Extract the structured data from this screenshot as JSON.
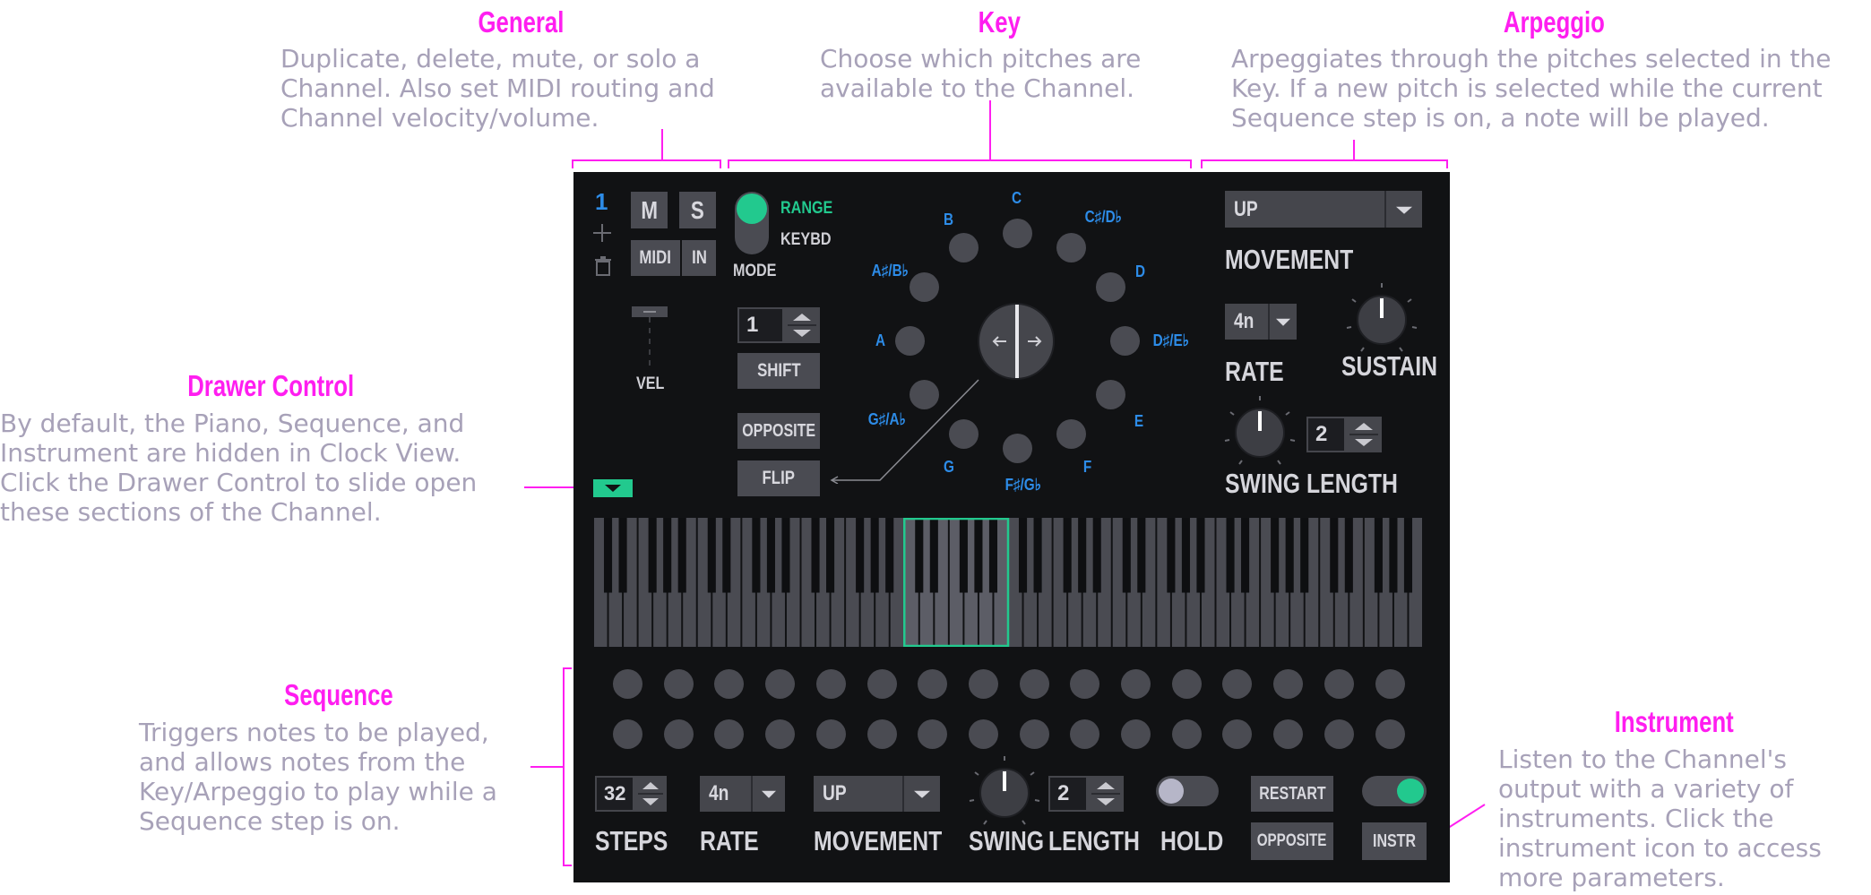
{
  "annotations": {
    "general": {
      "title": "General",
      "body": "Duplicate, delete, mute, or solo a\nChannel. Also set MIDI routing and\nChannel velocity/volume."
    },
    "key": {
      "title": "Key",
      "body": "Choose which pitches are\navailable to the Channel."
    },
    "arpeggio": {
      "title": "Arpeggio",
      "body": "Arpeggiates through the pitches selected in the\nKey. If a new pitch is selected while the current\nSequence step is on, a note will be played."
    },
    "drawer": {
      "title": "Drawer Control",
      "body": "By default, the Piano, Sequence, and\nInstrument are hidden in Clock View.\nClick the Drawer Control to slide open\nthese sections of the Channel."
    },
    "sequence": {
      "title": "Sequence",
      "body": "Triggers notes to be played,\nand allows notes from the\nKey/Arpeggio to play while a\nSequence step is on."
    },
    "instrument": {
      "title": "Instrument",
      "body": "Listen to the Channel's\noutput with a variety of\ninstruments. Click the\ninstrument icon to access\nmore parameters."
    }
  },
  "general": {
    "channel_number": "1",
    "add_icon": "plus-icon",
    "delete_icon": "trash-icon",
    "mute": "M",
    "solo": "S",
    "midi": "MIDI",
    "in": "IN",
    "velocity_label": "VEL"
  },
  "key": {
    "mode_options": [
      "RANGE",
      "KEYBD"
    ],
    "mode_selected": "RANGE",
    "mode_label": "MODE",
    "shift_value": "1",
    "shift": "SHIFT",
    "opposite": "OPPOSITE",
    "flip": "FLIP",
    "notes": [
      "C",
      "C♯/D♭",
      "D",
      "D♯/E♭",
      "E",
      "F",
      "F♯/G♭",
      "G",
      "G♯/A♭",
      "A",
      "A♯/B♭",
      "B"
    ]
  },
  "arpeggio": {
    "movement_value": "UP",
    "movement_label": "MOVEMENT",
    "rate_value": "4n",
    "rate_label": "RATE",
    "sustain_label": "SUSTAIN",
    "swing_label": "SWING",
    "length_value": "2",
    "length_label": "LENGTH"
  },
  "sequence": {
    "steps_value": "32",
    "steps_label": "STEPS",
    "rate_value": "4n",
    "rate_label": "RATE",
    "movement_value": "UP",
    "movement_label": "MOVEMENT",
    "swing_label": "SWING",
    "length_value": "2",
    "length_label": "LENGTH",
    "hold_label": "HOLD",
    "restart": "RESTART",
    "opposite": "OPPOSITE",
    "instr": "INSTR",
    "rows": 2,
    "steps_per_row": 16
  },
  "colors": {
    "accent_magenta": "#ff1ef0",
    "accent_green": "#22c98e",
    "note_blue": "#2d8ce8",
    "panel_bg": "#111214",
    "annotation_text": "#a7a1b8"
  }
}
